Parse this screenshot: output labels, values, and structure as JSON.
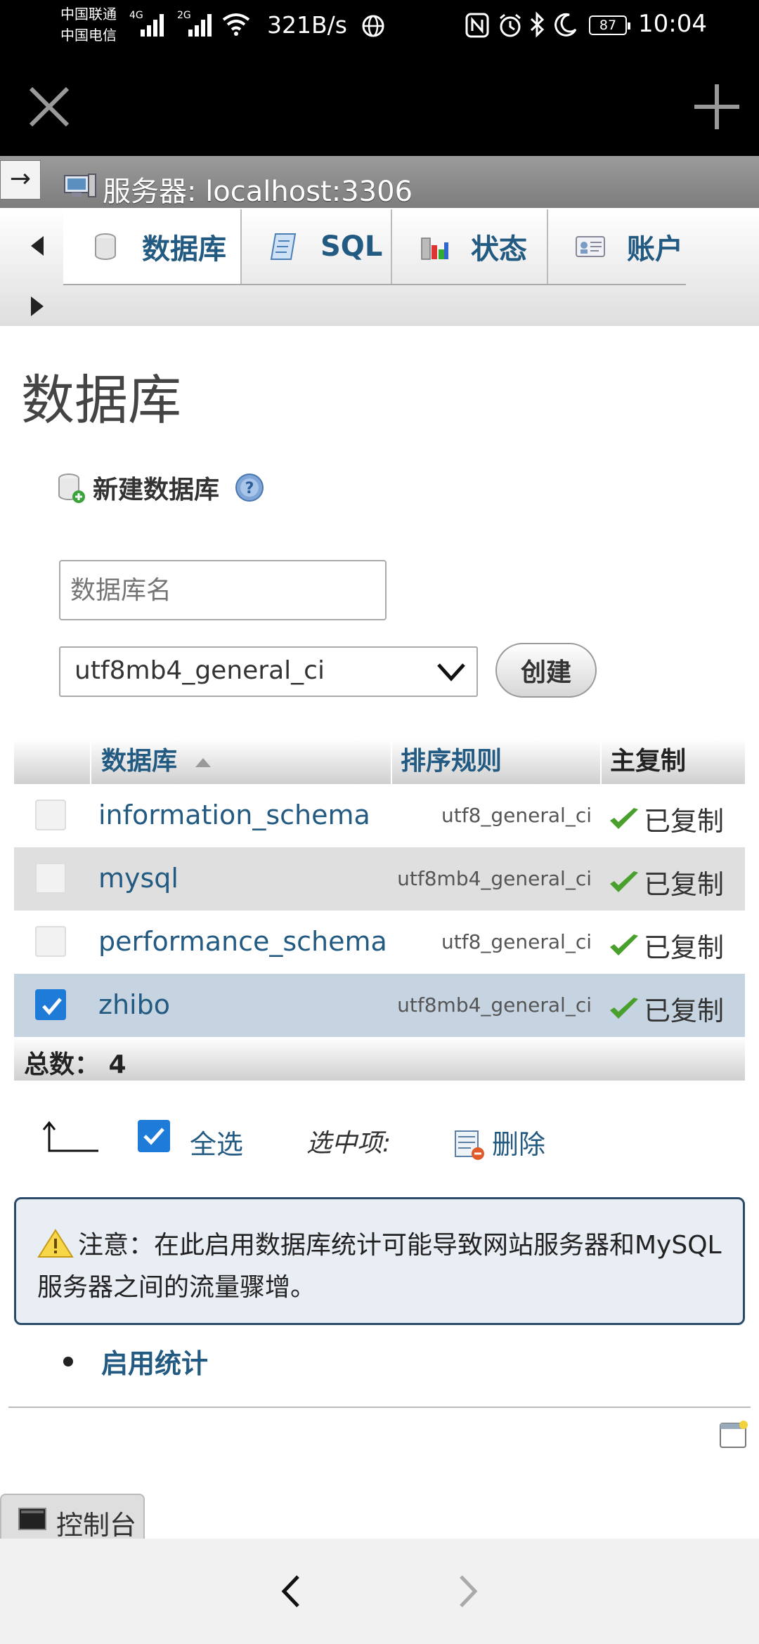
{
  "status_bar": {
    "carrier1": "中国联通",
    "carrier2": "中国电信",
    "net1": "4G",
    "net2": "2G",
    "speed": "321B/s",
    "battery": "87",
    "time": "10:04"
  },
  "server": {
    "label": "服务器: localhost:3306",
    "collapse": "→"
  },
  "tabs": [
    {
      "label": "数据库"
    },
    {
      "label": "SQL"
    },
    {
      "label": "状态"
    },
    {
      "label": "账户"
    }
  ],
  "page": {
    "title": "数据库",
    "new_db_label": "新建数据库",
    "db_name_placeholder": "数据库名",
    "collation_selected": "utf8mb4_general_ci",
    "create_label": "创建"
  },
  "table": {
    "headers": {
      "database": "数据库",
      "collation": "排序规则",
      "replication": "主复制"
    },
    "rows": [
      {
        "name": "information_schema",
        "collation": "utf8_general_ci",
        "replication": "已复制",
        "checked": false
      },
      {
        "name": "mysql",
        "collation": "utf8mb4_general_ci",
        "replication": "已复制",
        "checked": false
      },
      {
        "name": "performance_schema",
        "collation": "utf8_general_ci",
        "replication": "已复制",
        "checked": false
      },
      {
        "name": "zhibo",
        "collation": "utf8mb4_general_ci",
        "replication": "已复制",
        "checked": true
      }
    ],
    "total_label": "总数： 4"
  },
  "bulk": {
    "check_all": "全选",
    "selected": "选中项:",
    "delete": "删除"
  },
  "notice": {
    "text": "注意：在此启用数据库统计可能导致网站服务器和MySQL 服务器之间的流量骤增。"
  },
  "enable_stats": "启用统计",
  "console": "控制台",
  "colors": {
    "link": "#235a81",
    "checkbox": "#1f7bd8",
    "marked_row": "#c6d4e2"
  }
}
